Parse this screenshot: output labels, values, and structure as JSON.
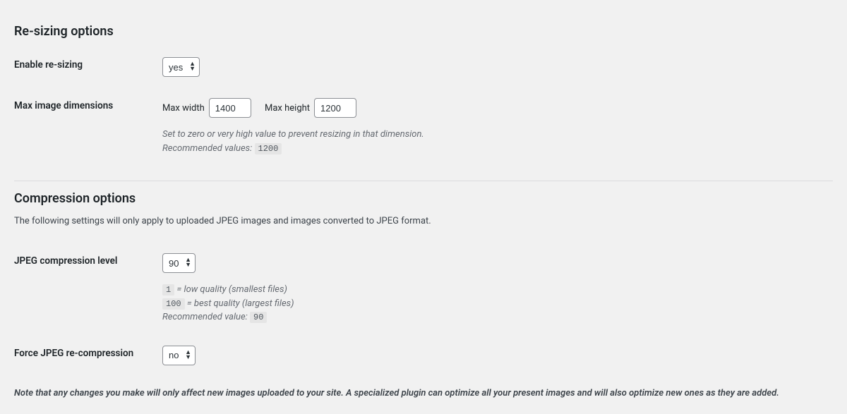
{
  "resizing": {
    "title": "Re-sizing options",
    "enable": {
      "label": "Enable re-sizing",
      "value": "yes"
    },
    "dimensions": {
      "label": "Max image dimensions",
      "max_width_label": "Max width",
      "max_width_value": "1400",
      "max_height_label": "Max height",
      "max_height_value": "1200",
      "help_line1": "Set to zero or very high value to prevent resizing in that dimension.",
      "recommended_label": "Recommended values:",
      "recommended_value": "1200"
    }
  },
  "compression": {
    "title": "Compression options",
    "desc": "The following settings will only apply to uploaded JPEG images and images converted to JPEG format.",
    "jpeg_level": {
      "label": "JPEG compression level",
      "value": "90",
      "low_code": "1",
      "low_text": " = low quality (smallest files)",
      "high_code": "100",
      "high_text": " = best quality (largest files)",
      "recommended_label": "Recommended value:",
      "recommended_value": "90"
    },
    "force_recompression": {
      "label": "Force JPEG re-compression",
      "value": "no"
    }
  },
  "footer_note": "Note that any changes you make will only affect new images uploaded to your site. A specialized plugin can optimize all your present images and will also optimize new ones as they are added."
}
